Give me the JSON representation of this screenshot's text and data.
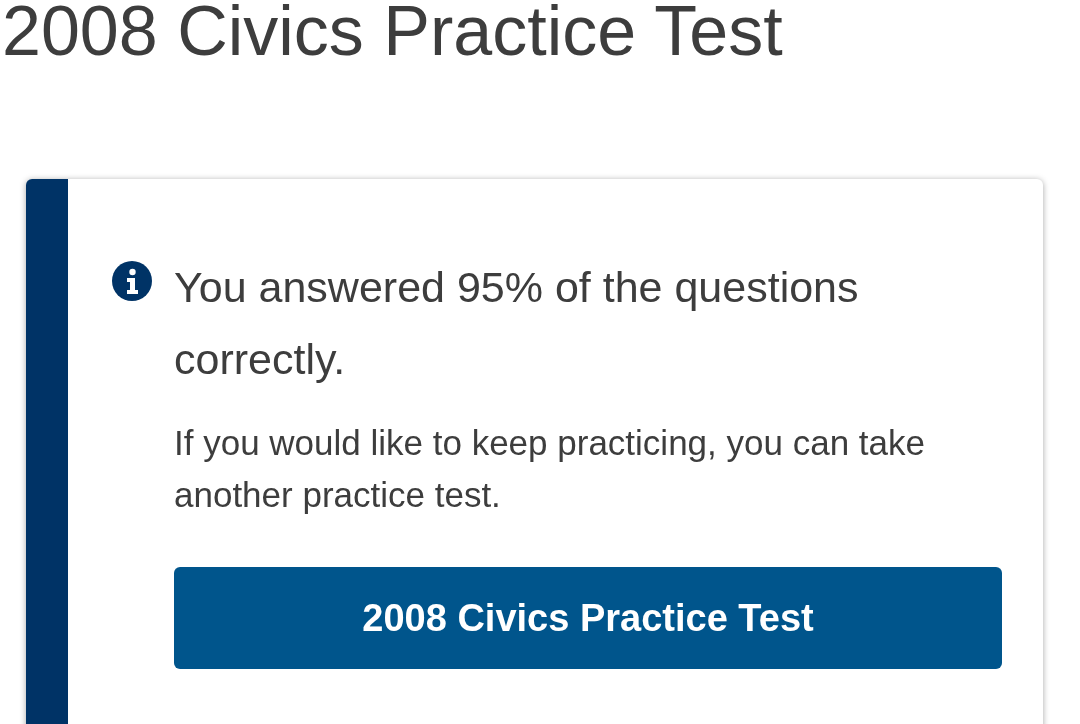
{
  "page_title": "2008 Civics Practice Test",
  "alert": {
    "kind": "info",
    "heading": "You answered 95% of the questions correctly.",
    "message": "If you would like to keep practicing, you can take another practice test.",
    "button": "2008 Civics Practice Test"
  }
}
